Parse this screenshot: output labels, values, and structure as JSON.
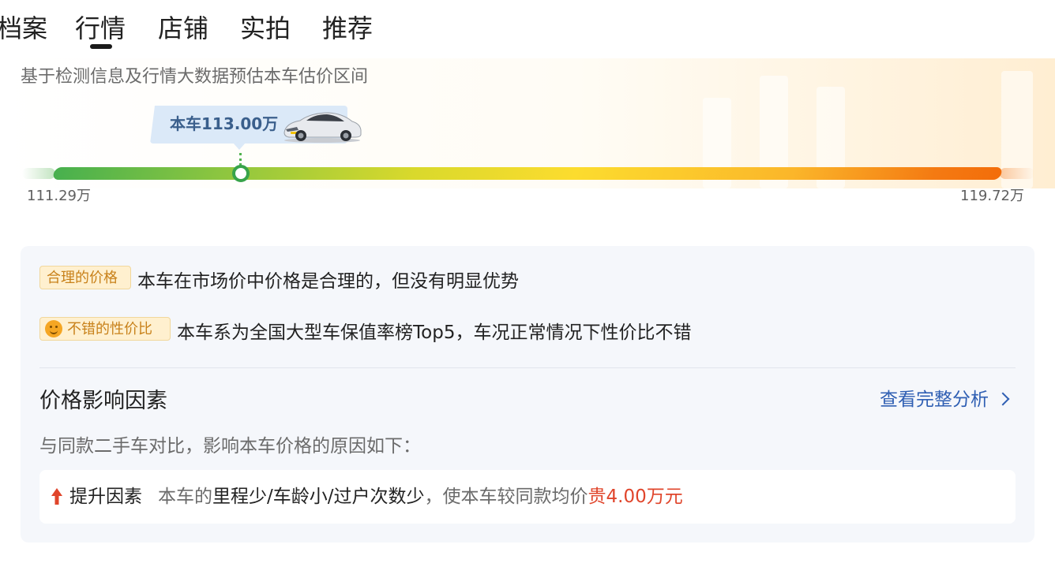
{
  "tabs": [
    {
      "label": "档案"
    },
    {
      "label": "行情",
      "active": true
    },
    {
      "label": "店铺"
    },
    {
      "label": "实拍"
    },
    {
      "label": "推荐"
    }
  ],
  "estimate": {
    "subtitle": "基于检测信息及行情大数据预估本车估价区间",
    "current_label": "本车113.00万",
    "min_label": "111.29万",
    "max_label": "119.72万",
    "current_value": 113.0,
    "min_value": 111.29,
    "max_value": 119.72
  },
  "analysis": {
    "badges": [
      {
        "label": "合理的价格",
        "description": "本车在市场价中价格是合理的，但没有明显优势"
      },
      {
        "label": "不错的性价比",
        "icon": "smile-icon",
        "description": "本车系为全国大型车保值率榜Top5，车况正常情况下性价比不错"
      }
    ],
    "factors_title": "价格影响因素",
    "view_full_analysis": "查看完整分析",
    "compare_text": "与同款二手车对比，影响本车价格的原因如下：",
    "factor": {
      "label": "提升因素",
      "prefix": "本车的",
      "highlight": "里程少/车龄小/过户次数少",
      "middle": "，使本车较同款均价",
      "price_text": "贵4.00万元"
    }
  },
  "colors": {
    "accent_blue": "#2f5fb3",
    "price_red": "#e0452b",
    "badge_text": "#c8811a",
    "marker_green": "#38a34a"
  }
}
